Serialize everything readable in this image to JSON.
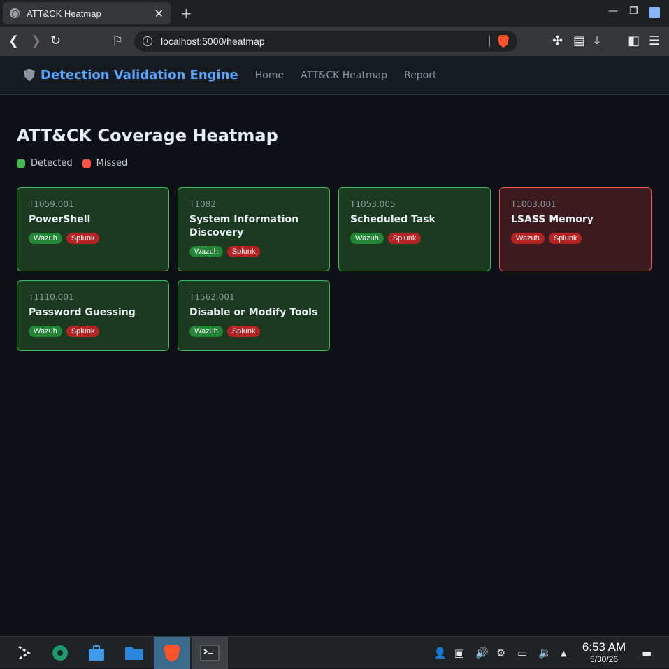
{
  "browser": {
    "tab_title": "ATT&CK Heatmap",
    "tab_close": "✕",
    "new_tab": "+",
    "url": "localhost:5000/heatmap"
  },
  "app": {
    "brand": "Detection Validation Engine",
    "nav": [
      "Home",
      "ATT&CK Heatmap",
      "Report"
    ]
  },
  "page": {
    "title": "ATT&CK Coverage Heatmap",
    "legend": [
      {
        "label": "Detected",
        "color": "#3fb950"
      },
      {
        "label": "Missed",
        "color": "#f85149"
      }
    ]
  },
  "techniques": [
    {
      "id": "T1059.001",
      "name": "PowerShell",
      "status": "detected",
      "wazuh": "Wazuh",
      "splunk": "Splunk"
    },
    {
      "id": "T1082",
      "name": "System Information Discovery",
      "status": "detected",
      "wazuh": "Wazuh",
      "splunk": "Splunk"
    },
    {
      "id": "T1053.005",
      "name": "Scheduled Task",
      "status": "detected",
      "wazuh": "Wazuh",
      "splunk": "Splunk"
    },
    {
      "id": "T1003.001",
      "name": "LSASS Memory",
      "status": "missed",
      "wazuh": "Wazuh",
      "splunk": "Splunk"
    },
    {
      "id": "T1110.001",
      "name": "Password Guessing",
      "status": "detected",
      "wazuh": "Wazuh",
      "splunk": "Splunk"
    },
    {
      "id": "T1562.001",
      "name": "Disable or Modify Tools",
      "status": "detected",
      "wazuh": "Wazuh",
      "splunk": "Splunk"
    }
  ],
  "taskbar": {
    "time": "6:53 AM",
    "date": "5/30/26"
  },
  "colors": {
    "detected_bg": "#1b3a1f",
    "missed_bg": "#3b1b1e",
    "brand": "#58a6ff"
  }
}
